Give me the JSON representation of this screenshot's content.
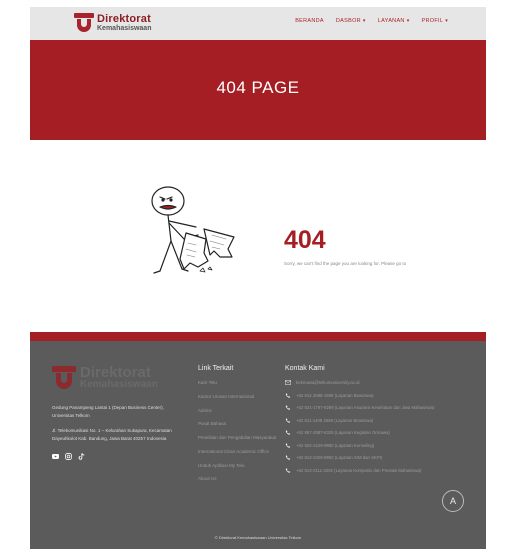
{
  "header": {
    "logo_line1": "Direktorat",
    "logo_line2": "Kemahasiswaan",
    "nav": [
      {
        "label": "BERANDA",
        "has_caret": false
      },
      {
        "label": "DASBOR",
        "has_caret": true
      },
      {
        "label": "LAYANAN",
        "has_caret": true
      },
      {
        "label": "PROFIL",
        "has_caret": true
      }
    ]
  },
  "hero": {
    "title": "404 PAGE"
  },
  "error": {
    "code": "404",
    "message": "Sorry, we can't find the page you are looking for. Please go to"
  },
  "footer": {
    "logo_line1": "Direktorat",
    "logo_line2": "Kemahasiswaan",
    "address1": "Gedung Panampeng Lantai 1 (Depan Business Center), Universitas Telkom",
    "address2": "Jl. Telekomunikasi No. 1 – Kelurahan Sukapura, Kecamatan Dayeuhkolot Kab. Bandung, Jawa Barat 40257 Indonesia",
    "social": [
      "youtube-icon",
      "instagram-icon",
      "tiktok-icon"
    ],
    "links_title": "Link Terkait",
    "links": [
      "Karir Telu",
      "Kantor Urusan Internasional",
      "Admisi",
      "Pusat Bahasa",
      "Penelitian dan Pengabdian Masyarakat",
      "International Class Academic Office",
      "Unduh Aplikasi My Telu",
      "About Us"
    ],
    "contact_title": "Kontak Kami",
    "contacts": [
      {
        "icon": "mail-icon",
        "text": "bekmawa@telkomuniversity.ac.id"
      },
      {
        "icon": "phone-icon",
        "text": "+62 812 2088-1599 (Layanan Beasiswa)"
      },
      {
        "icon": "phone-icon",
        "text": "+62 821-1797-8289 (Layanan Asuransi Kesehatan dan Jiwa Mahasiswa)"
      },
      {
        "icon": "phone-icon",
        "text": "+62 811-1408 2688 (Layanan Beasiswa)"
      },
      {
        "icon": "phone-icon",
        "text": "+62 857-2087-8326 (Layanan Kegiatan Ormawa)"
      },
      {
        "icon": "phone-icon",
        "text": "+62 822-2229-9980 (Layanan Konseling)"
      },
      {
        "icon": "phone-icon",
        "text": "+62 813-2329-8950 (Layanan SIM dan SKPI)"
      },
      {
        "icon": "phone-icon",
        "text": "+62 813-2111-3282 (Layanan Kompetisi dan Prestasi Mahasiswa)"
      }
    ],
    "back_to_top": "A",
    "copyright": "© Direktorat Kemahasiswaan Universitas Telkom"
  },
  "colors": {
    "brand_red": "#a41e24",
    "header_bg": "#e6e6e6",
    "footer_bg": "#5b5b5b"
  }
}
